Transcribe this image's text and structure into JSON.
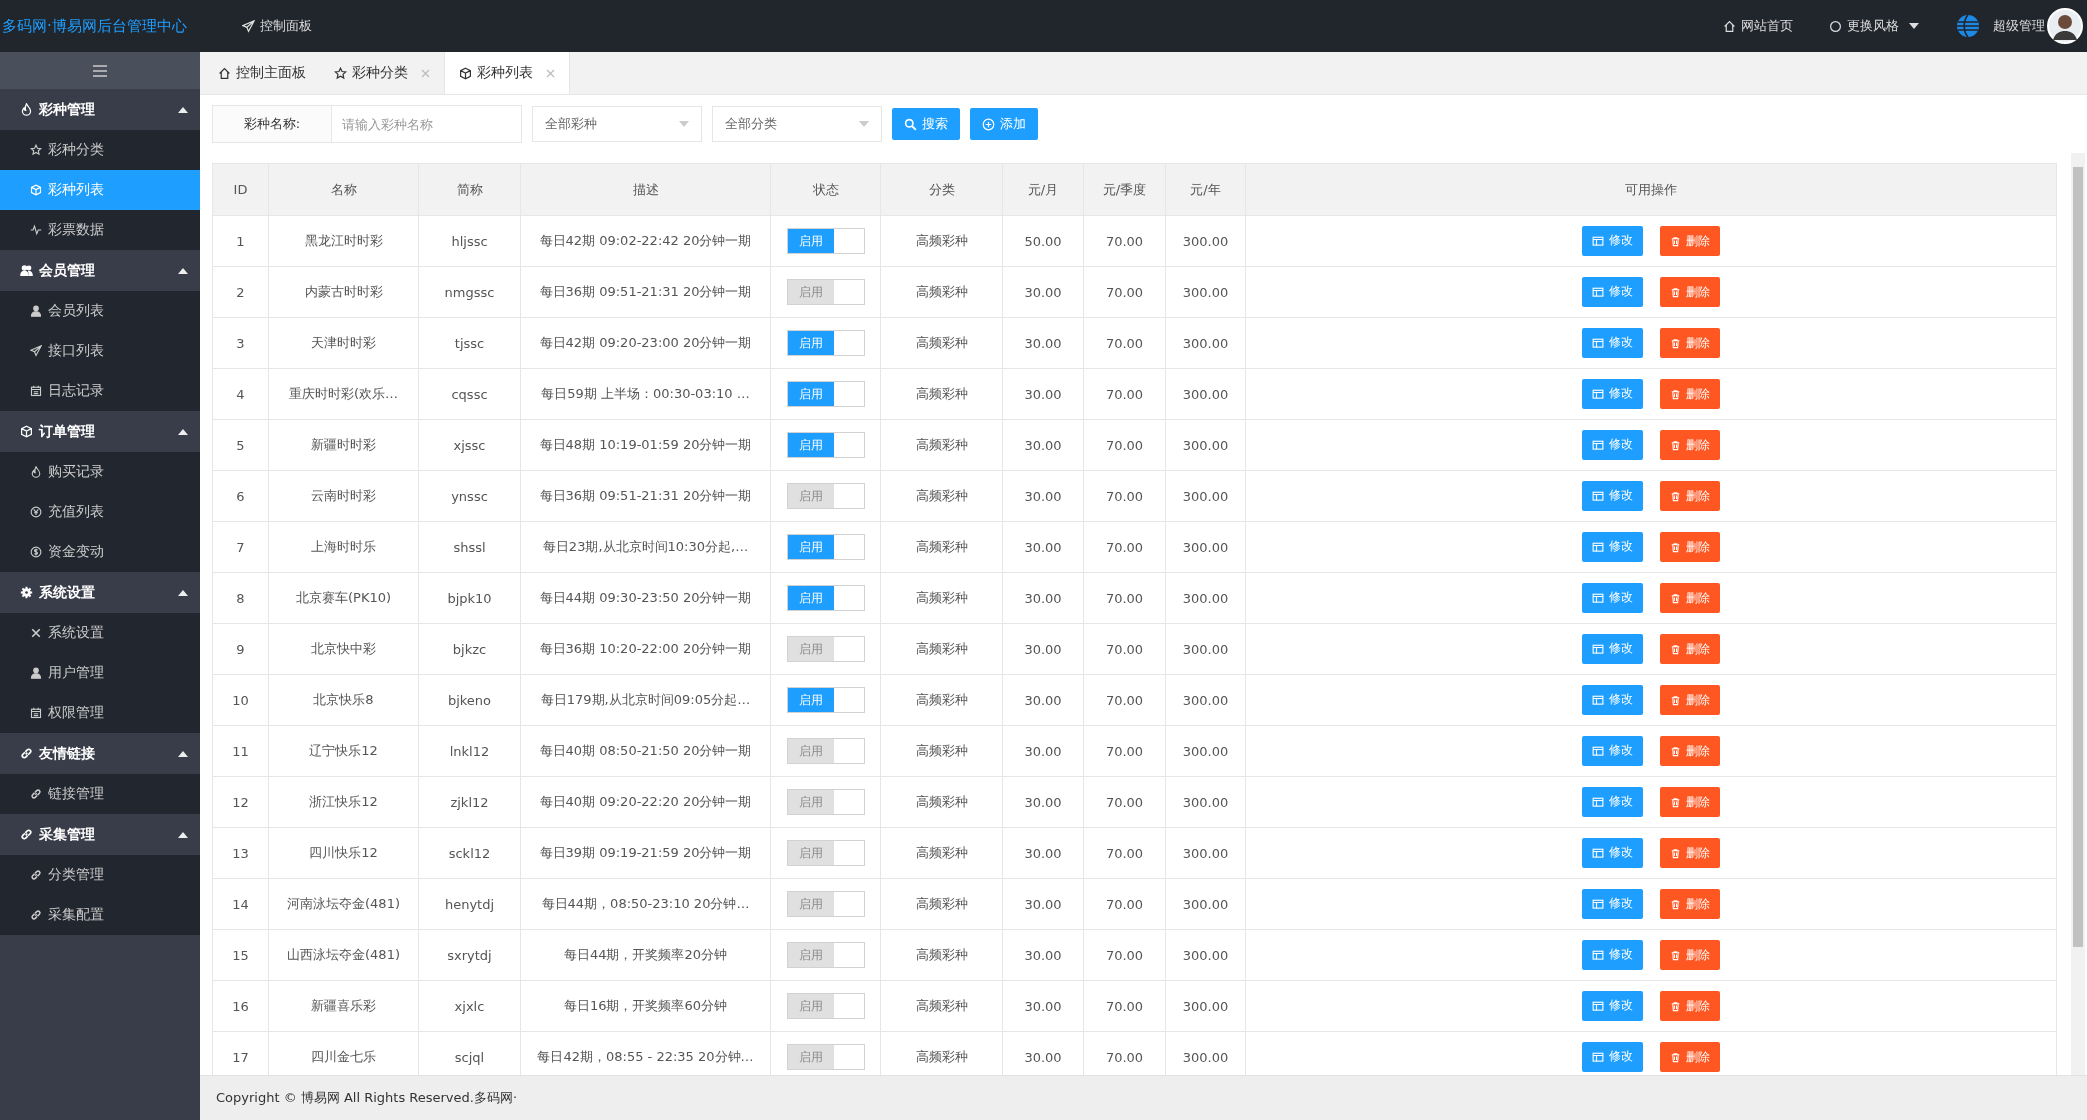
{
  "header": {
    "brand": "多码网·博易网后台管理中心",
    "nav_link": "控制面板",
    "home_link": "网站首页",
    "theme_menu": "更换风格",
    "user_name": "超级管理"
  },
  "sidebar": {
    "groups": [
      {
        "label": "彩种管理",
        "expanded": true,
        "items": [
          {
            "label": "彩种分类",
            "selected": false
          },
          {
            "label": "彩种列表",
            "selected": true
          },
          {
            "label": "彩票数据",
            "selected": false
          }
        ]
      },
      {
        "label": "会员管理",
        "expanded": true,
        "items": [
          {
            "label": "会员列表",
            "selected": false
          },
          {
            "label": "接口列表",
            "selected": false
          },
          {
            "label": "日志记录",
            "selected": false
          }
        ]
      },
      {
        "label": "订单管理",
        "expanded": true,
        "items": [
          {
            "label": "购买记录",
            "selected": false
          },
          {
            "label": "充值列表",
            "selected": false
          },
          {
            "label": "资金变动",
            "selected": false
          }
        ]
      },
      {
        "label": "系统设置",
        "expanded": true,
        "items": [
          {
            "label": "系统设置",
            "selected": false
          },
          {
            "label": "用户管理",
            "selected": false
          },
          {
            "label": "权限管理",
            "selected": false
          }
        ]
      },
      {
        "label": "友情链接",
        "expanded": true,
        "items": [
          {
            "label": "链接管理",
            "selected": false
          }
        ]
      },
      {
        "label": "采集管理",
        "expanded": true,
        "items": [
          {
            "label": "分类管理",
            "selected": false
          },
          {
            "label": "采集配置",
            "selected": false
          }
        ]
      }
    ]
  },
  "tabs": [
    {
      "label": "控制主面板",
      "selected": false,
      "closable": false
    },
    {
      "label": "彩种分类",
      "selected": false,
      "closable": true
    },
    {
      "label": "彩种列表",
      "selected": true,
      "closable": true
    }
  ],
  "filter": {
    "label": "彩种名称:",
    "placeholder": "请输入彩种名称",
    "type_select": "全部彩种",
    "category_select": "全部分类",
    "search_button": "搜索",
    "add_button": "添加"
  },
  "table": {
    "columns": [
      "ID",
      "名称",
      "简称",
      "描述",
      "状态",
      "分类",
      "元/月",
      "元/季度",
      "元/年",
      "可用操作"
    ],
    "rows": [
      {
        "id": "1",
        "name": "黑龙江时时彩",
        "code": "hljssc",
        "description": "每日42期 09:02-22:42 20分钟一期",
        "status_label": "启用",
        "on": true,
        "category": "高频彩种",
        "monthly": "50.00",
        "quarterly": "70.00",
        "yearly": "300.00",
        "edit": "修改",
        "delete": "删除"
      },
      {
        "id": "2",
        "name": "内蒙古时时彩",
        "code": "nmgssc",
        "description": "每日36期 09:51-21:31 20分钟一期",
        "status_label": "启用",
        "on": false,
        "category": "高频彩种",
        "monthly": "30.00",
        "quarterly": "70.00",
        "yearly": "300.00",
        "edit": "修改",
        "delete": "删除"
      },
      {
        "id": "3",
        "name": "天津时时彩",
        "code": "tjssc",
        "description": "每日42期 09:20-23:00 20分钟一期",
        "status_label": "启用",
        "on": true,
        "category": "高频彩种",
        "monthly": "30.00",
        "quarterly": "70.00",
        "yearly": "300.00",
        "edit": "修改",
        "delete": "删除"
      },
      {
        "id": "4",
        "name": "重庆时时彩(欢乐…",
        "code": "cqssc",
        "description": "每日59期 上半场：00:30-03:10 …",
        "status_label": "启用",
        "on": true,
        "category": "高频彩种",
        "monthly": "30.00",
        "quarterly": "70.00",
        "yearly": "300.00",
        "edit": "修改",
        "delete": "删除"
      },
      {
        "id": "5",
        "name": "新疆时时彩",
        "code": "xjssc",
        "description": "每日48期 10:19-01:59 20分钟一期",
        "status_label": "启用",
        "on": true,
        "category": "高频彩种",
        "monthly": "30.00",
        "quarterly": "70.00",
        "yearly": "300.00",
        "edit": "修改",
        "delete": "删除"
      },
      {
        "id": "6",
        "name": "云南时时彩",
        "code": "ynssc",
        "description": "每日36期 09:51-21:31 20分钟一期",
        "status_label": "启用",
        "on": false,
        "category": "高频彩种",
        "monthly": "30.00",
        "quarterly": "70.00",
        "yearly": "300.00",
        "edit": "修改",
        "delete": "删除"
      },
      {
        "id": "7",
        "name": "上海时时乐",
        "code": "shssl",
        "description": "每日23期,从北京时间10:30分起,…",
        "status_label": "启用",
        "on": true,
        "category": "高频彩种",
        "monthly": "30.00",
        "quarterly": "70.00",
        "yearly": "300.00",
        "edit": "修改",
        "delete": "删除"
      },
      {
        "id": "8",
        "name": "北京赛车(PK10)",
        "code": "bjpk10",
        "description": "每日44期 09:30-23:50 20分钟一期",
        "status_label": "启用",
        "on": true,
        "category": "高频彩种",
        "monthly": "30.00",
        "quarterly": "70.00",
        "yearly": "300.00",
        "edit": "修改",
        "delete": "删除"
      },
      {
        "id": "9",
        "name": "北京快中彩",
        "code": "bjkzc",
        "description": "每日36期 10:20-22:00 20分钟一期",
        "status_label": "启用",
        "on": false,
        "category": "高频彩种",
        "monthly": "30.00",
        "quarterly": "70.00",
        "yearly": "300.00",
        "edit": "修改",
        "delete": "删除"
      },
      {
        "id": "10",
        "name": "北京快乐8",
        "code": "bjkeno",
        "description": "每日179期,从北京时间09:05分起…",
        "status_label": "启用",
        "on": true,
        "category": "高频彩种",
        "monthly": "30.00",
        "quarterly": "70.00",
        "yearly": "300.00",
        "edit": "修改",
        "delete": "删除"
      },
      {
        "id": "11",
        "name": "辽宁快乐12",
        "code": "lnkl12",
        "description": "每日40期 08:50-21:50 20分钟一期",
        "status_label": "启用",
        "on": false,
        "category": "高频彩种",
        "monthly": "30.00",
        "quarterly": "70.00",
        "yearly": "300.00",
        "edit": "修改",
        "delete": "删除"
      },
      {
        "id": "12",
        "name": "浙江快乐12",
        "code": "zjkl12",
        "description": "每日40期 09:20-22:20 20分钟一期",
        "status_label": "启用",
        "on": false,
        "category": "高频彩种",
        "monthly": "30.00",
        "quarterly": "70.00",
        "yearly": "300.00",
        "edit": "修改",
        "delete": "删除"
      },
      {
        "id": "13",
        "name": "四川快乐12",
        "code": "sckl12",
        "description": "每日39期 09:19-21:59 20分钟一期",
        "status_label": "启用",
        "on": false,
        "category": "高频彩种",
        "monthly": "30.00",
        "quarterly": "70.00",
        "yearly": "300.00",
        "edit": "修改",
        "delete": "删除"
      },
      {
        "id": "14",
        "name": "河南泳坛夺金(481)",
        "code": "henytdj",
        "description": "每日44期，08:50-23:10 20分钟…",
        "status_label": "启用",
        "on": false,
        "category": "高频彩种",
        "monthly": "30.00",
        "quarterly": "70.00",
        "yearly": "300.00",
        "edit": "修改",
        "delete": "删除"
      },
      {
        "id": "15",
        "name": "山西泳坛夺金(481)",
        "code": "sxrytdj",
        "description": "每日44期，开奖频率20分钟",
        "status_label": "启用",
        "on": false,
        "category": "高频彩种",
        "monthly": "30.00",
        "quarterly": "70.00",
        "yearly": "300.00",
        "edit": "修改",
        "delete": "删除"
      },
      {
        "id": "16",
        "name": "新疆喜乐彩",
        "code": "xjxlc",
        "description": "每日16期，开奖频率60分钟",
        "status_label": "启用",
        "on": false,
        "category": "高频彩种",
        "monthly": "30.00",
        "quarterly": "70.00",
        "yearly": "300.00",
        "edit": "修改",
        "delete": "删除"
      },
      {
        "id": "17",
        "name": "四川金七乐",
        "code": "scjql",
        "description": "每日42期，08:55 - 22:35 20分钟…",
        "status_label": "启用",
        "on": false,
        "category": "高频彩种",
        "monthly": "30.00",
        "quarterly": "70.00",
        "yearly": "300.00",
        "edit": "修改",
        "delete": "删除"
      }
    ]
  },
  "footer": "Copyright © 博易网 All Rights Reserved.多码网·"
}
